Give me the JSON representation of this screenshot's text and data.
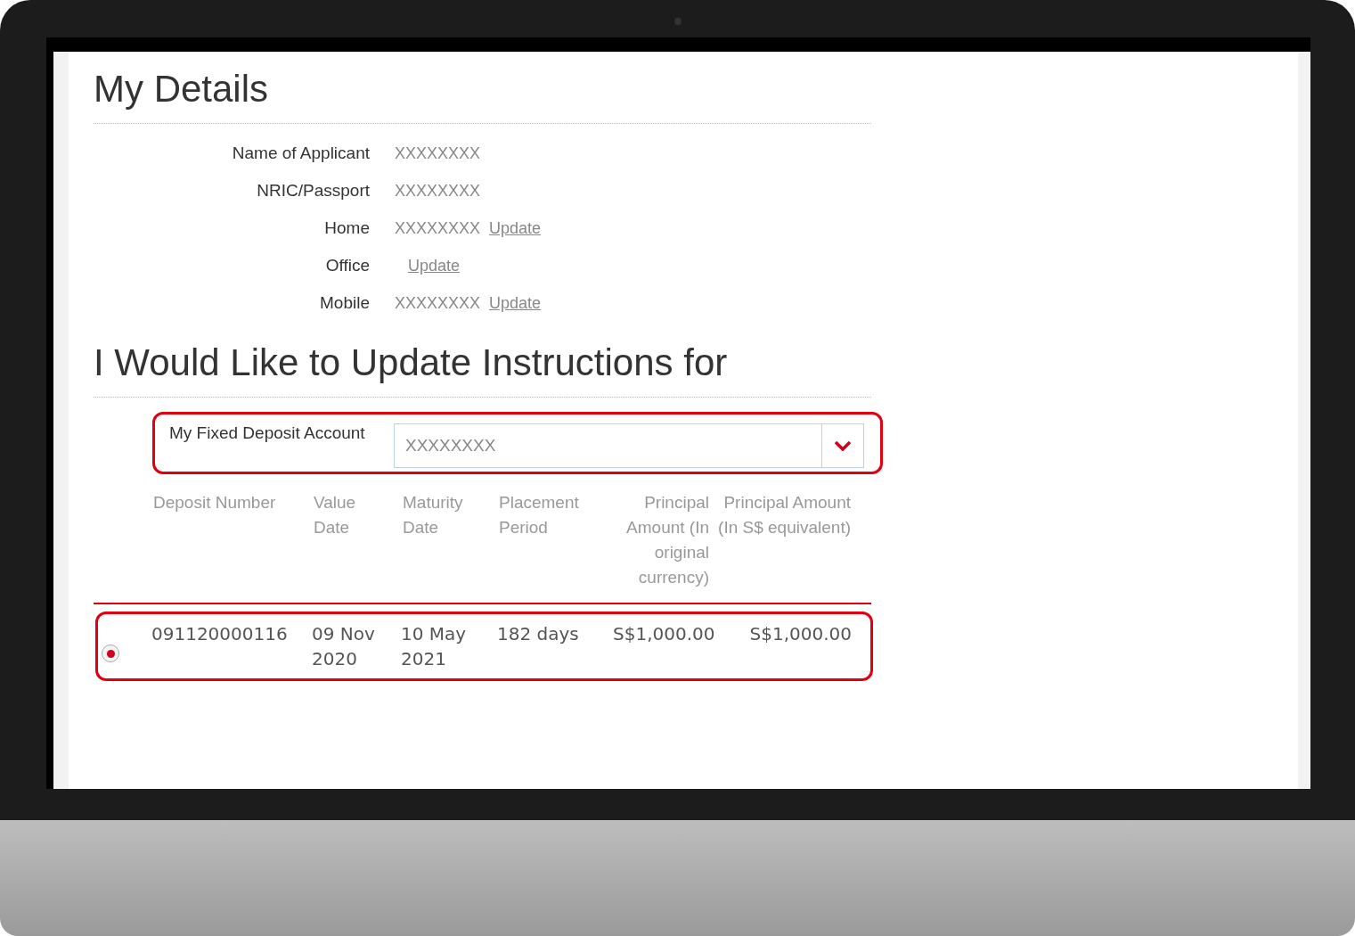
{
  "my_details": {
    "title": "My Details",
    "fields": [
      {
        "label": "Name of Applicant",
        "value": "XXXXXXXX"
      },
      {
        "label": "NRIC/Passport",
        "value": "XXXXXXXX"
      },
      {
        "label": "Home",
        "value": "XXXXXXXX",
        "link": "Update"
      },
      {
        "label": "Office",
        "link": "Update"
      },
      {
        "label": "Mobile",
        "value": "XXXXXXXX",
        "link": "Update"
      }
    ]
  },
  "update_instructions": {
    "title": "I Would Like to Update Instructions for",
    "account_select": {
      "label": "My Fixed Deposit Account",
      "value": "XXXXXXXX"
    },
    "table": {
      "columns": [
        "Deposit Number",
        "Value Date",
        "Maturity Date",
        "Placement Period",
        "Principal Amount (In original currency)",
        "Principal Amount (In S$ equivalent)"
      ],
      "rows": [
        {
          "selected": true,
          "cells": [
            "091120000116",
            "09 Nov 2020",
            "10 May 2021",
            "182 days",
            "S$1,000.00",
            "S$1,000.00"
          ]
        }
      ]
    }
  }
}
